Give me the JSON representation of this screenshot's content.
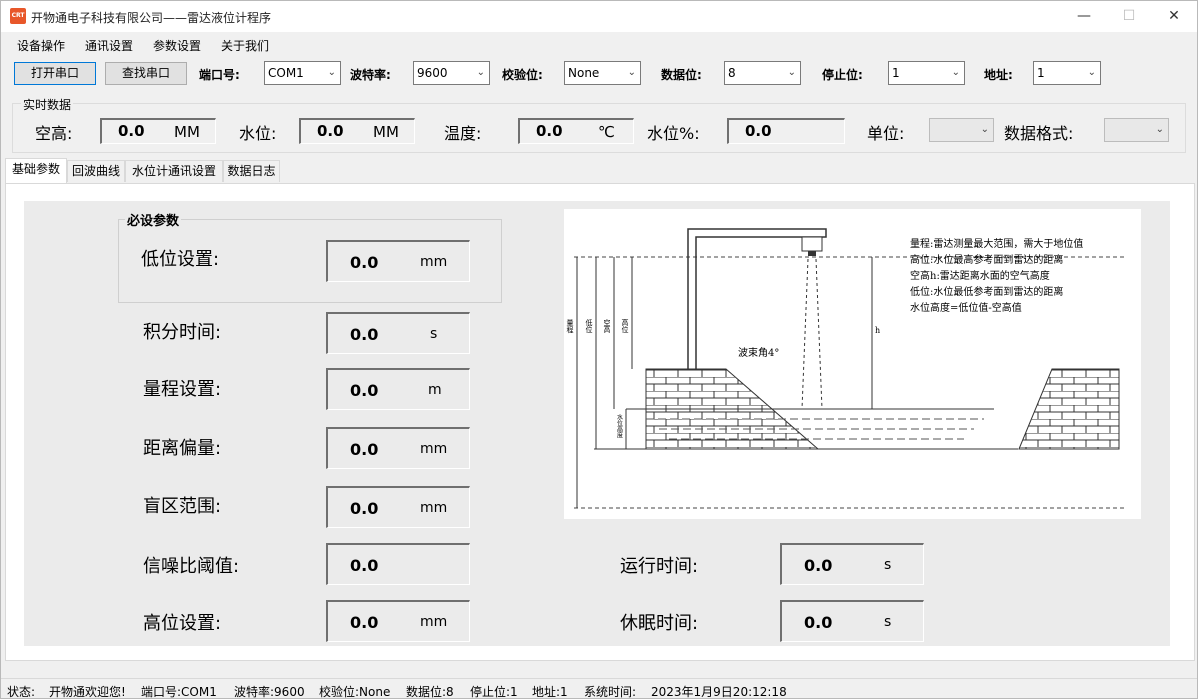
{
  "window": {
    "logo_text": "CRT",
    "title": "开物通电子科技有限公司——雷达液位计程序",
    "minimize": "—",
    "maximize": "☐",
    "close": "✕"
  },
  "menu": [
    "设备操作",
    "通讯设置",
    "参数设置",
    "关于我们"
  ],
  "toolbar": {
    "open_port": "打开串口",
    "find_port": "查找串口",
    "port_label": "端口号:",
    "port_value": "COM1",
    "baud_label": "波特率:",
    "baud_value": "9600",
    "parity_label": "校验位:",
    "parity_value": "None",
    "databits_label": "数据位:",
    "databits_value": "8",
    "stopbits_label": "停止位:",
    "stopbits_value": "1",
    "address_label": "地址:",
    "address_value": "1"
  },
  "realtime": {
    "group_label": "实时数据",
    "air_height_label": "空高:",
    "air_height_value": "0.0",
    "air_height_unit": "MM",
    "level_label": "水位:",
    "level_value": "0.0",
    "level_unit": "MM",
    "temp_label": "温度:",
    "temp_value": "0.0",
    "temp_unit": "℃",
    "level_pct_label": "水位%:",
    "level_pct_value": "0.0",
    "unit_label": "单位:",
    "format_label": "数据格式:"
  },
  "tabs": [
    "基础参数",
    "回波曲线",
    "水位计通讯设置",
    "数据日志"
  ],
  "params": {
    "required_group": "必设参数",
    "low_label": "低位设置:",
    "low_value": "0.0",
    "low_unit": "mm",
    "integral_label": "积分时间:",
    "integral_value": "0.0",
    "integral_unit": "s",
    "range_label": "量程设置:",
    "range_value": "0.0",
    "range_unit": "m",
    "offset_label": "距离偏量:",
    "offset_value": "0.0",
    "offset_unit": "mm",
    "blind_label": "盲区范围:",
    "blind_value": "0.0",
    "blind_unit": "mm",
    "snr_label": "信噪比阈值:",
    "snr_value": "0.0",
    "high_label": "高位设置:",
    "high_value": "0.0",
    "high_unit": "mm",
    "run_label": "运行时间:",
    "run_value": "0.0",
    "run_unit": "s",
    "sleep_label": "休眠时间:",
    "sleep_value": "0.0",
    "sleep_unit": "s"
  },
  "diagram": {
    "notes": [
      "量程:雷达测量最大范围，需大于地位值",
      "高位:水位最高参考面到雷达的距离",
      "空高h:雷达距离水面的空气高度",
      "低位:水位最低参考面到雷达的距离",
      "水位高度=低位值-空高值"
    ],
    "beam_label": "波束角4°",
    "v_labels": [
      "量程",
      "低位",
      "空高",
      "高位"
    ],
    "h_label": "h",
    "water_height_label": "水位高度"
  },
  "status": {
    "state_label": "状态:",
    "state_value": "开物通欢迎您!",
    "port": "端口号:COM1",
    "baud": "波特率:9600",
    "parity": "校验位:None",
    "databits": "数据位:8",
    "stopbits": "停止位:1",
    "address": "地址:1",
    "systime_label": "系统时间:",
    "systime_value": "2023年1月9日20:12:18"
  }
}
